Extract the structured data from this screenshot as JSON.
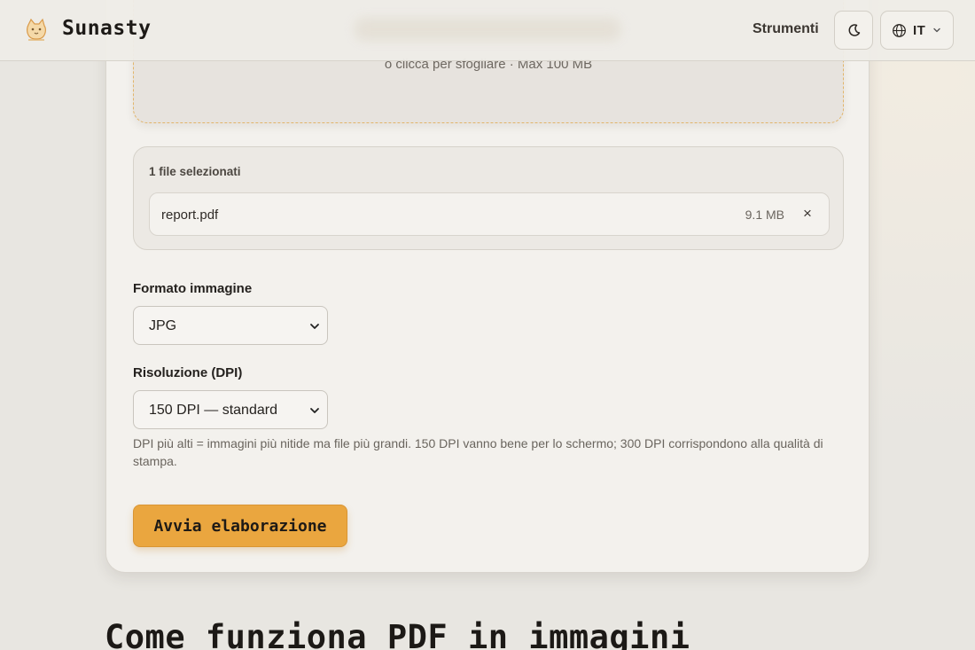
{
  "header": {
    "brand": "Sunasty",
    "nav_tools": "Strumenti",
    "language": "IT",
    "icons": {
      "logo": "cat-logo-icon",
      "theme": "moon-icon",
      "language": "globe-icon",
      "dropdown": "chevron-down-icon"
    }
  },
  "upload": {
    "hint": "o clicca per sfogliare · Max 100 MB"
  },
  "files": {
    "count_label": "1 file selezionati",
    "items": [
      {
        "name": "report.pdf",
        "size": "9.1 MB",
        "remove": "×"
      }
    ]
  },
  "format": {
    "label": "Formato immagine",
    "value": "JPG"
  },
  "dpi": {
    "label": "Risoluzione (DPI)",
    "value": "150 DPI — standard",
    "help": "DPI più alti = immagini più nitide ma file più grandi. 150 DPI vanno bene per lo schermo; 300 DPI corrispondono alla qualità di stampa."
  },
  "actions": {
    "start": "Avvia elaborazione"
  },
  "section": {
    "title": "Come funziona PDF in immagini"
  },
  "colors": {
    "accent": "#eaa63f",
    "background": "#e8e6e1",
    "card": "#f3f1ed"
  }
}
